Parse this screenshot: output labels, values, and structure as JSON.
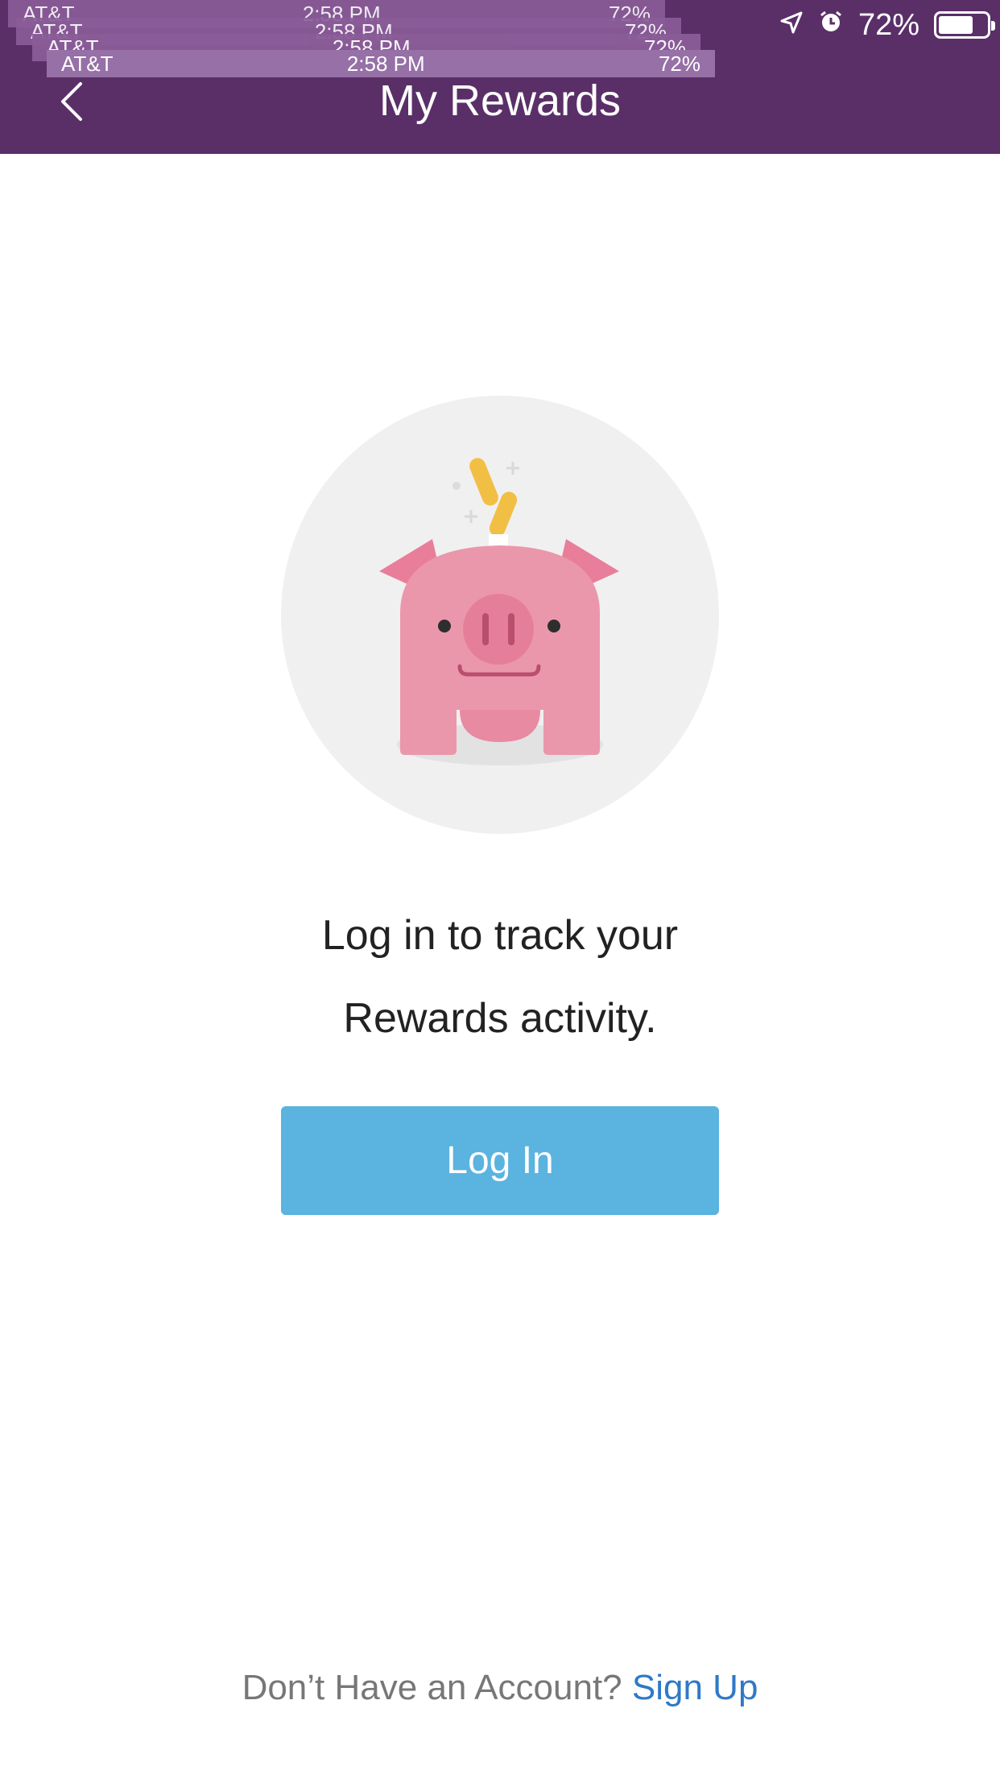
{
  "status_bar": {
    "carrier": "AT&T",
    "time": "2:58 PM",
    "battery_percent": "72%",
    "icons": [
      "signal-icon",
      "wifi-icon",
      "location-icon",
      "alarm-icon",
      "battery-icon"
    ]
  },
  "header": {
    "title": "My Rewards",
    "back_icon": "chevron-left-icon",
    "background_color": "#5a2f68"
  },
  "illustration": {
    "name": "piggy-bank-icon",
    "circle_color": "#f0f0f0",
    "pig_color": "#eb97ab",
    "coin_color": "#f2bf45"
  },
  "message": {
    "line1": "Log in to track your",
    "line2": "Rewards activity."
  },
  "login_button": {
    "label": "Log In",
    "color": "#5bb3df"
  },
  "footer": {
    "question": "Don’t Have an Account?",
    "link": "Sign Up",
    "link_color": "#2f79c7"
  }
}
